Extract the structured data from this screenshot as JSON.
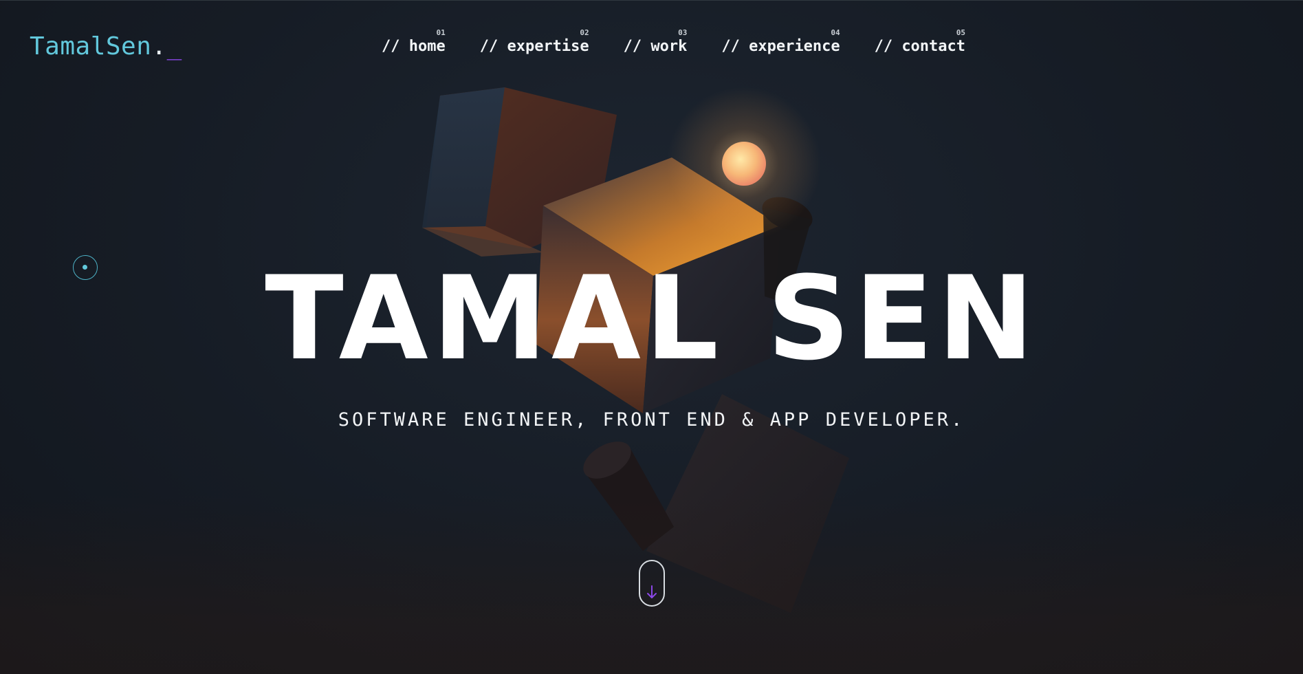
{
  "brand": {
    "name": "TamalSen",
    "dot": ".",
    "cursor": "_",
    "colors": {
      "name": "#62c8dc",
      "cursor": "#8b47e6",
      "background": "#161c25"
    }
  },
  "nav": {
    "items": [
      {
        "number": "01",
        "label": "// home"
      },
      {
        "number": "02",
        "label": "// expertise"
      },
      {
        "number": "03",
        "label": "// work"
      },
      {
        "number": "04",
        "label": "// experience"
      },
      {
        "number": "05",
        "label": "// contact"
      }
    ]
  },
  "hero": {
    "title": "TAMAL SEN",
    "subtitle": "SOFTWARE ENGINEER, FRONT END & APP DEVELOPER."
  },
  "scroll": {
    "icon": "arrow-down-icon",
    "icon_color": "#8b47e6"
  },
  "cursor_indicator": {
    "icon": "cursor-ring-icon",
    "color": "#4eb3c8"
  }
}
